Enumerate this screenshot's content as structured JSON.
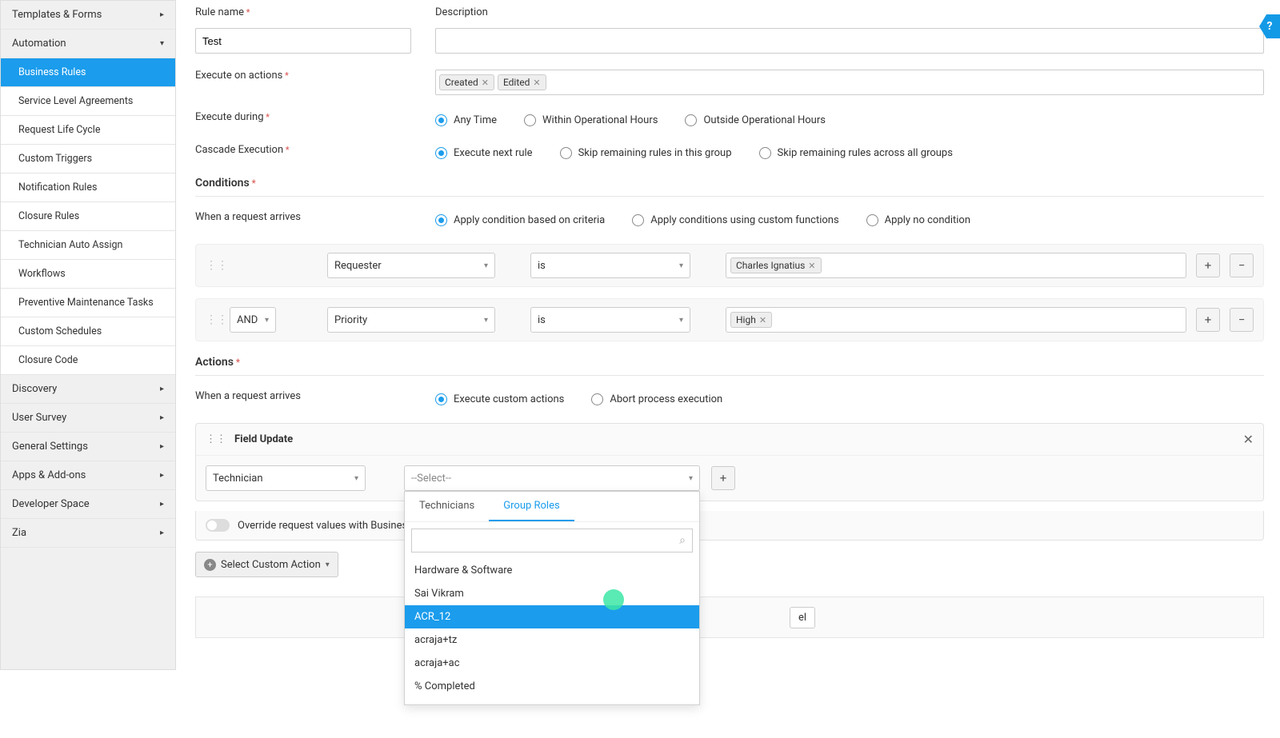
{
  "sidebar": {
    "topItems": [
      {
        "label": "Templates & Forms",
        "chev": "▸"
      }
    ],
    "automationLabel": "Automation",
    "automationSub": [
      {
        "label": "Business Rules",
        "active": true
      },
      {
        "label": "Service Level Agreements"
      },
      {
        "label": "Request Life Cycle"
      },
      {
        "label": "Custom Triggers"
      },
      {
        "label": "Notification Rules"
      },
      {
        "label": "Closure Rules"
      },
      {
        "label": "Technician Auto Assign"
      },
      {
        "label": "Workflows"
      },
      {
        "label": "Preventive Maintenance Tasks"
      },
      {
        "label": "Custom Schedules"
      },
      {
        "label": "Closure Code"
      }
    ],
    "bottomItems": [
      {
        "label": "Discovery",
        "chev": "▸"
      },
      {
        "label": "User Survey",
        "chev": "▸"
      },
      {
        "label": "General Settings",
        "chev": "▸"
      },
      {
        "label": "Apps & Add-ons",
        "chev": "▸"
      },
      {
        "label": "Developer Space",
        "chev": "▸"
      },
      {
        "label": "Zia",
        "chev": "▸"
      }
    ]
  },
  "form": {
    "ruleNameLabel": "Rule name",
    "ruleNameValue": "Test",
    "descriptionLabel": "Description",
    "descriptionValue": "",
    "executeOnLabel": "Execute on actions",
    "executeOnTags": [
      "Created",
      "Edited"
    ],
    "executeDuringLabel": "Execute during",
    "executeDuringOptions": [
      "Any Time",
      "Within Operational Hours",
      "Outside Operational Hours"
    ],
    "cascadeLabel": "Cascade Execution",
    "cascadeOptions": [
      "Execute next rule",
      "Skip remaining rules in this group",
      "Skip remaining rules across all groups"
    ],
    "conditionsLabel": "Conditions",
    "whenRequestLabel": "When a request arrives",
    "conditionModes": [
      "Apply condition based on criteria",
      "Apply conditions using custom functions",
      "Apply no condition"
    ],
    "cond1": {
      "field": "Requester",
      "op": "is",
      "value": "Charles Ignatius"
    },
    "cond2": {
      "join": "AND",
      "field": "Priority",
      "op": "is",
      "value": "High"
    },
    "actionsLabel": "Actions",
    "actionModes": [
      "Execute custom actions",
      "Abort process execution"
    ],
    "fieldUpdateLabel": "Field Update",
    "technicianSel": "Technician",
    "selectPlaceholder": "--Select--",
    "ddTabs": [
      "Technicians",
      "Group Roles"
    ],
    "ddItems": [
      "Hardware & Software",
      "Sai Vikram",
      "ACR_12",
      "acraja+tz",
      "acraja+ac",
      "% Completed"
    ],
    "overrideLabel": "Override request values with Business R",
    "customActionLabel": "Select Custom Action",
    "cancelFrag": "el",
    "helpGlyph": "?"
  }
}
